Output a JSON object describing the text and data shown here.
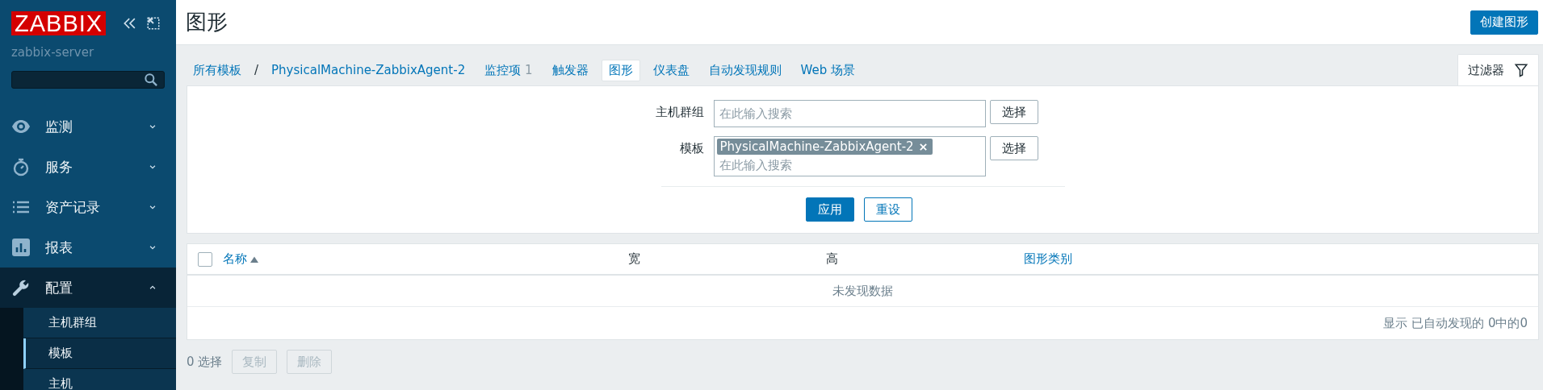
{
  "sidebar": {
    "logo": "ZABBIX",
    "server": "zabbix-server",
    "menu": [
      {
        "label": "监测",
        "expanded": false
      },
      {
        "label": "服务",
        "expanded": false
      },
      {
        "label": "资产记录",
        "expanded": false
      },
      {
        "label": "报表",
        "expanded": false
      },
      {
        "label": "配置",
        "expanded": true,
        "children": [
          {
            "label": "主机群组",
            "selected": false
          },
          {
            "label": "模板",
            "selected": true
          },
          {
            "label": "主机",
            "selected": false
          }
        ]
      }
    ]
  },
  "header": {
    "title": "图形",
    "create_button": "创建图形"
  },
  "breadcrumbs": [
    {
      "label": "所有模板",
      "kind": "link"
    },
    {
      "label": "/",
      "kind": "separator"
    },
    {
      "label": "PhysicalMachine-ZabbixAgent-2",
      "kind": "link"
    }
  ],
  "tabs": [
    {
      "label": "监控项",
      "count": "1",
      "selected": false
    },
    {
      "label": "触发器",
      "selected": false
    },
    {
      "label": "图形",
      "selected": true
    },
    {
      "label": "仪表盘",
      "selected": false
    },
    {
      "label": "自动发现规则",
      "selected": false
    },
    {
      "label": "Web 场景",
      "selected": false
    }
  ],
  "filter": {
    "tab": "过滤器",
    "expanded": true,
    "fields": [
      {
        "label": "主机群组",
        "placeholder": "在此输入搜索",
        "button": "选择"
      },
      {
        "label": "模板",
        "tags": [
          "PhysicalMachine-ZabbixAgent-2"
        ],
        "placeholder": "在此输入搜索",
        "button": "选择"
      }
    ],
    "apply": "应用",
    "reset": "重设"
  },
  "table": {
    "columns": [
      {
        "label": "名称",
        "sortable": true,
        "sorted": true
      },
      {
        "label": "宽",
        "sortable": false,
        "sorted": false
      },
      {
        "label": "高",
        "sortable": false,
        "sorted": false
      },
      {
        "label": "图形类别",
        "sortable": true,
        "sorted": false
      }
    ],
    "empty": "未发现数据",
    "footer": "显示 已自动发现的 0中的0",
    "all_checked": false
  },
  "actions": {
    "selected": "0 选择",
    "buttons": [
      {
        "label": "复制",
        "disabled": true
      },
      {
        "label": "删除",
        "disabled": true
      }
    ]
  }
}
